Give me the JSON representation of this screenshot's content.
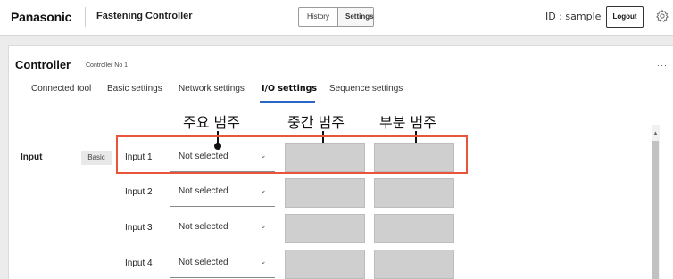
{
  "header": {
    "brand": "Panasonic",
    "app_title": "Fastening Controller",
    "tabs": {
      "history": "History",
      "settings": "Settings"
    },
    "user_id": "ID : sample",
    "logout_label": "Logout"
  },
  "controller": {
    "title": "Controller",
    "subtitle": "Controller No 1",
    "more": "···"
  },
  "tabs": [
    {
      "label": "Connected tool"
    },
    {
      "label": "Basic settings"
    },
    {
      "label": "Network settings"
    },
    {
      "label": "I/O settings",
      "active": true
    },
    {
      "label": "Sequence settings"
    }
  ],
  "annotations": {
    "major": "주요 범주",
    "middle": "중간 범주",
    "sub": "부분 범주"
  },
  "io": {
    "section_label": "Input",
    "badge": "Basic",
    "rows": [
      {
        "label": "Input 1",
        "value": "Not selected"
      },
      {
        "label": "Input 2",
        "value": "Not selected"
      },
      {
        "label": "Input 3",
        "value": "Not selected"
      },
      {
        "label": "Input 4",
        "value": "Not selected"
      }
    ]
  },
  "colors": {
    "accent": "#2a66c4",
    "highlight": "#e8553a",
    "box": "#cfcfcf"
  }
}
